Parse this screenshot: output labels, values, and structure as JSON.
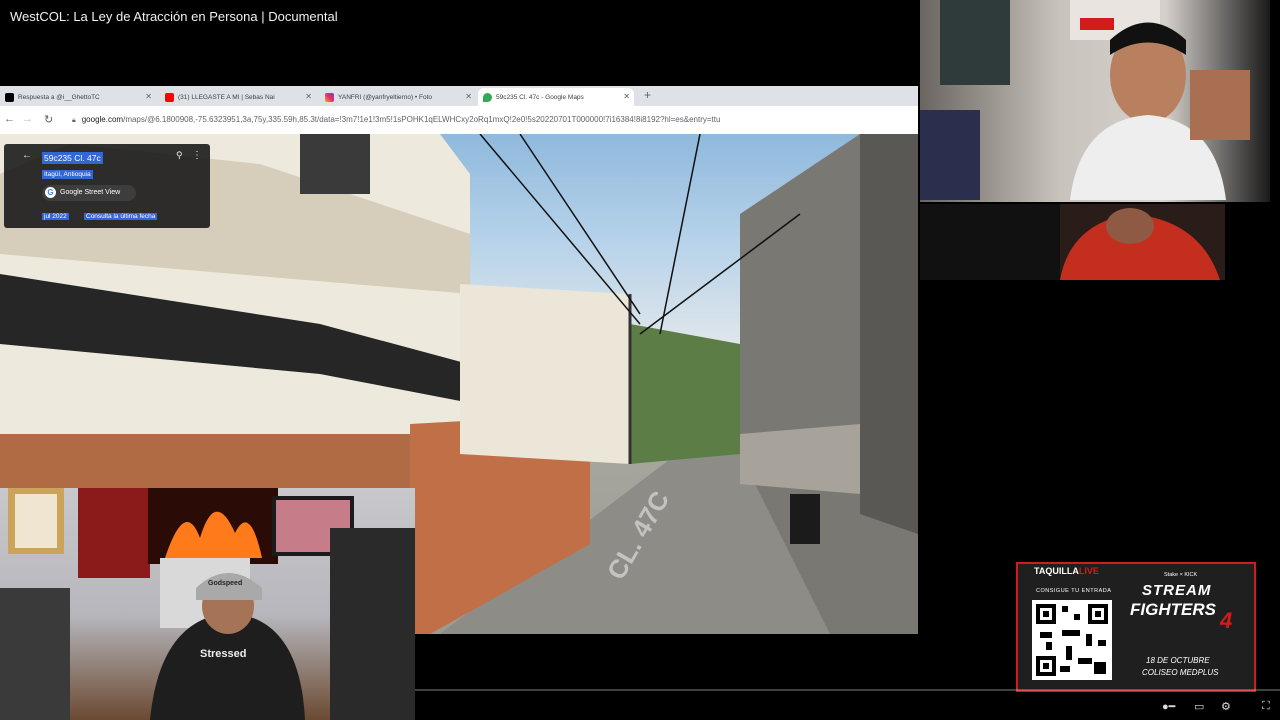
{
  "video": {
    "title": "WestCOL: La Ley de Atracción en Persona | Documental"
  },
  "browser": {
    "tabs": [
      {
        "label": "Respuesta a @i__GhettoTC"
      },
      {
        "label": "(31) LLEGASTE A MI | Sebas Nai"
      },
      {
        "label": "YANFRI (@yanfryeltierno) • Foto"
      },
      {
        "label": "59c235 Cl. 47c - Google Maps"
      }
    ],
    "url_host": "google.com",
    "url_path": "/maps/@6.1800908,-75.6323951,3a,75y,335.59h,85.3t/data=!3m7!1e1!3m5!1sPOHK1qELWHCxy2oRq1mxQ!2e0!5s20220701T000000!7i16384!8i8192?hl=es&entry=ttu"
  },
  "streetview": {
    "place_title": "59c235 Cl. 47c",
    "place_subtitle": "Itagüí, Antioquia",
    "source_label": "Google Street View",
    "capture_date": "jul 2022",
    "latest_link": "Consulta la última fecha",
    "street_marking": "CL. 47C"
  },
  "ad": {
    "brand": "TAQUILLA",
    "brand_accent": "LIVE",
    "cta": "CONSIGUE TU ENTRADA",
    "sponsors": "Stake × KICK",
    "title_line1": "STREAM",
    "title_line2": "FIGHTERS",
    "title_number": "4",
    "date": "18 DE OCTUBRE",
    "venue": "COLISEO MEDPLUS"
  },
  "webcam_left": {
    "cap_text": "Godspeed",
    "shirt_text": "Stressed"
  },
  "colors": {
    "browser_chrome": "#dee1e6",
    "maps_highlight": "#3367d6",
    "ad_red": "#d21b1b"
  },
  "icons": [
    "back-arrow-icon",
    "reload-icon",
    "forward-arrow-icon",
    "location-pin-icon",
    "more-vert-icon",
    "close-icon",
    "new-tab-icon",
    "settings-icon",
    "fullscreen-icon"
  ]
}
